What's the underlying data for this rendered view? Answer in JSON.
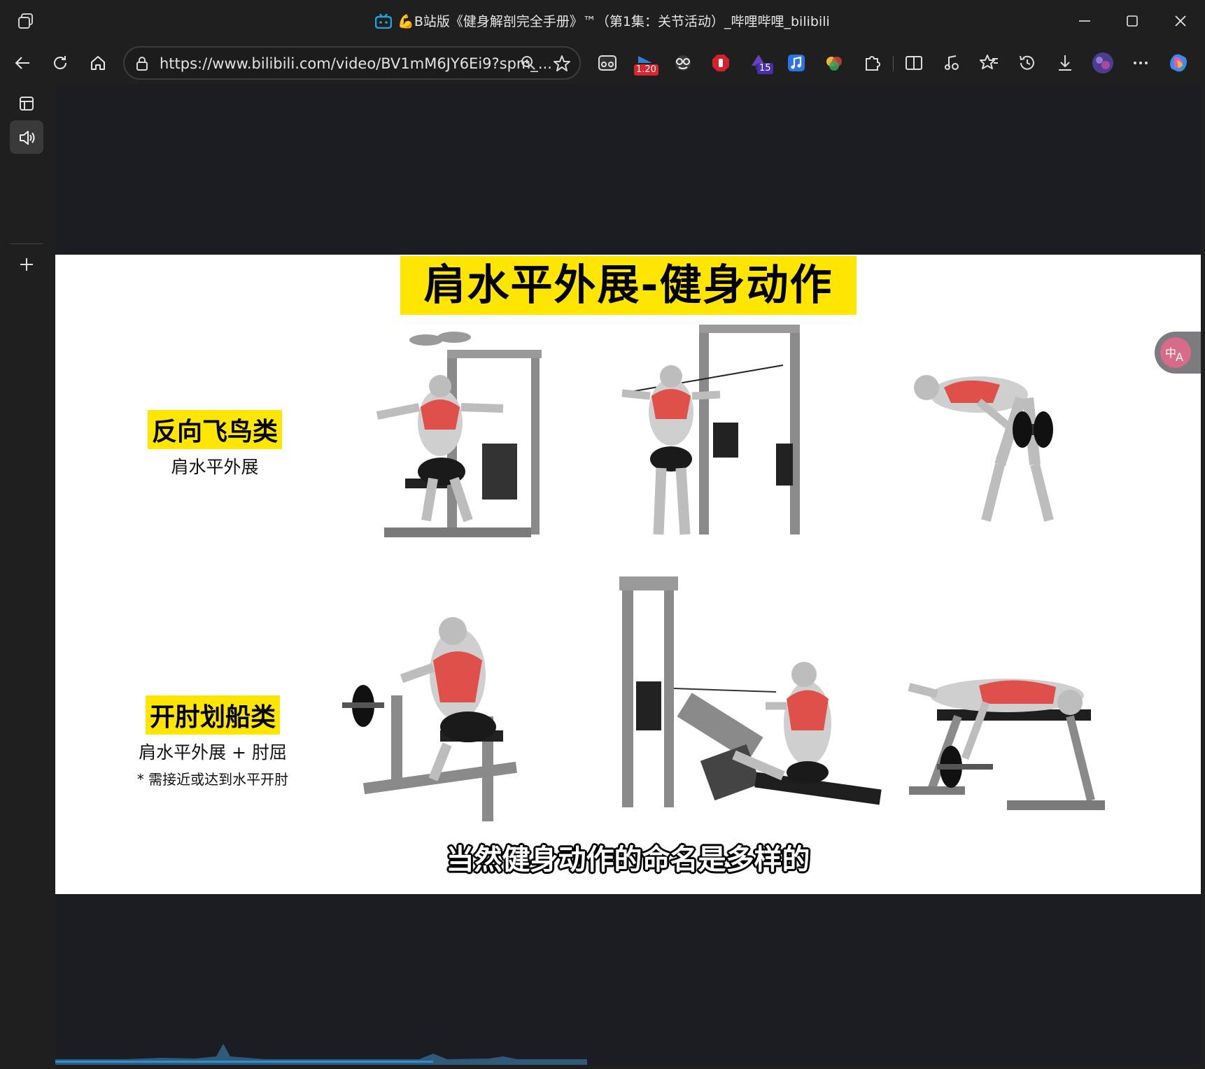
{
  "window": {
    "title": "💪B站版《健身解剖完全手册》™（第1集：关节活动）_哔哩哔哩_bilibili"
  },
  "address": {
    "url": "https://www.bilibili.com/video/BV1mM6JY6Ei9?spm_..."
  },
  "extensions": {
    "speed_badge": "1.20",
    "count_badge": "15"
  },
  "video": {
    "slide_title": "肩水平外展-健身动作",
    "group1": {
      "tag": "反向飞鸟类",
      "desc": "肩水平外展"
    },
    "group2": {
      "tag": "开肘划船类",
      "desc": "肩水平外展 + 肘屈",
      "note": "* 需接近或达到水平开肘"
    },
    "subtitle": "当然健身动作的命名是多样的"
  },
  "colors": {
    "accent_yellow": "#ffe600",
    "muscle_red": "#e0504a",
    "chrome_bg": "#1f1f1f"
  }
}
